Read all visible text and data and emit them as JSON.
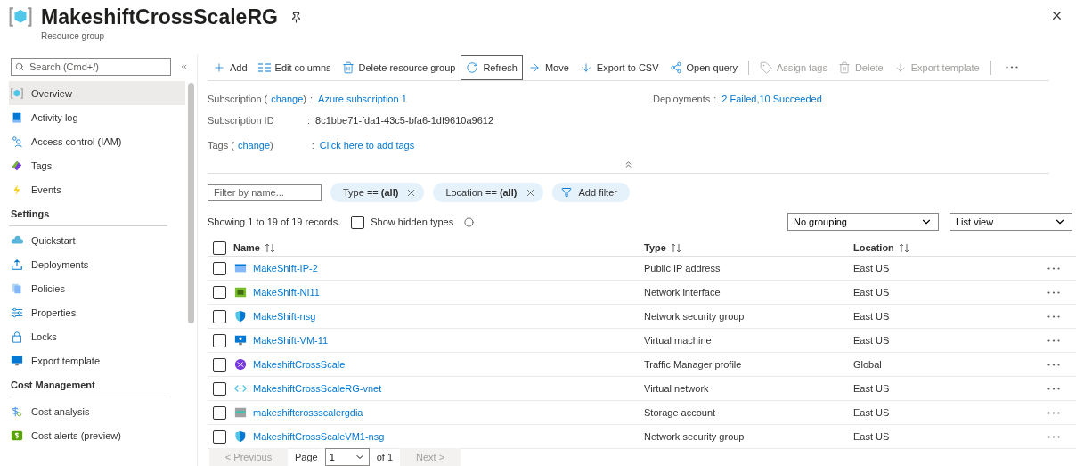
{
  "header": {
    "title": "MakeshiftCrossScaleRG",
    "subtitle": "Resource group"
  },
  "sidebar": {
    "search": {
      "placeholder": "Search (Cmd+/)"
    },
    "sections": [
      {
        "items": [
          {
            "label": "Overview",
            "selected": true
          },
          {
            "label": "Activity log",
            "selected": false
          },
          {
            "label": "Access control (IAM)",
            "selected": false
          },
          {
            "label": "Tags",
            "selected": false
          },
          {
            "label": "Events",
            "selected": false
          }
        ]
      },
      {
        "heading": "Settings",
        "items": [
          {
            "label": "Quickstart",
            "selected": false
          },
          {
            "label": "Deployments",
            "selected": false
          },
          {
            "label": "Policies",
            "selected": false
          },
          {
            "label": "Properties",
            "selected": false
          },
          {
            "label": "Locks",
            "selected": false
          },
          {
            "label": "Export template",
            "selected": false
          }
        ]
      },
      {
        "heading": "Cost Management",
        "items": [
          {
            "label": "Cost analysis",
            "selected": false
          },
          {
            "label": "Cost alerts (preview)",
            "selected": false
          }
        ]
      }
    ]
  },
  "toolbar": [
    {
      "kind": "button",
      "label": "Add",
      "disabled": false,
      "focused": false
    },
    {
      "kind": "button",
      "label": "Edit columns",
      "disabled": false,
      "focused": false
    },
    {
      "kind": "button",
      "label": "Delete resource group",
      "disabled": false,
      "focused": false
    },
    {
      "kind": "button",
      "label": "Refresh",
      "disabled": false,
      "focused": true
    },
    {
      "kind": "button",
      "label": "Move",
      "disabled": false,
      "focused": false
    },
    {
      "kind": "button",
      "label": "Export to CSV",
      "disabled": false,
      "focused": false
    },
    {
      "kind": "button",
      "label": "Open query",
      "disabled": false,
      "focused": false
    },
    {
      "kind": "separator"
    },
    {
      "kind": "button",
      "label": "Assign tags",
      "disabled": true,
      "focused": false
    },
    {
      "kind": "button",
      "label": "Delete",
      "disabled": true,
      "focused": false
    },
    {
      "kind": "button",
      "label": "Export template",
      "disabled": true,
      "focused": false
    },
    {
      "kind": "separator"
    },
    {
      "kind": "more"
    }
  ],
  "essentials": {
    "subscription": {
      "label": "Subscription (",
      "change": "change",
      "after": ")",
      "separator": ":",
      "value": "Azure subscription 1"
    },
    "subscription_id": {
      "label": "Subscription ID",
      "separator": ":",
      "value": "8c1bbe71-fda1-43c5-bfa6-1df9610a9612"
    },
    "tags": {
      "label": "Tags (",
      "change": "change",
      "after": ")",
      "separator": ":",
      "value": "Click here to add tags"
    },
    "deployments": {
      "label": "Deployments",
      "separator": ":",
      "value": "2 Failed,10 Succeeded"
    }
  },
  "filters": {
    "placeholder": "Filter by name...",
    "pills": [
      {
        "label": "Type == **(all)**"
      },
      {
        "label": "Location == **(all)**"
      }
    ],
    "add_filter": "Add filter"
  },
  "summary": {
    "text": "Showing 1 to 19 of 19 records.",
    "show_hidden": {
      "label": "Show hidden types",
      "checked": false
    },
    "grouping": "No grouping",
    "view": "List view"
  },
  "table": {
    "columns": [
      "Name",
      "Type",
      "Location"
    ],
    "all_checked": false,
    "rows": [
      {
        "name": "MakeShift-IP-2",
        "type": "Public IP address",
        "location": "East US",
        "checked": false
      },
      {
        "name": "MakeShift-NI11",
        "type": "Network interface",
        "location": "East US",
        "checked": false
      },
      {
        "name": "MakeShift-nsg",
        "type": "Network security group",
        "location": "East US",
        "checked": false
      },
      {
        "name": "MakeShift-VM-11",
        "type": "Virtual machine",
        "location": "East US",
        "checked": false
      },
      {
        "name": "MakeshiftCrossScale",
        "type": "Traffic Manager profile",
        "location": "Global",
        "checked": false
      },
      {
        "name": "MakeshiftCrossScaleRG-vnet",
        "type": "Virtual network",
        "location": "East US",
        "checked": false
      },
      {
        "name": "makeshiftcrossscalergdia",
        "type": "Storage account",
        "location": "East US",
        "checked": false
      },
      {
        "name": "MakeshiftCrossScaleVM1-nsg",
        "type": "Network security group",
        "location": "East US",
        "checked": false
      }
    ]
  },
  "pager": {
    "previous": "< Previous",
    "page_label": "Page",
    "page": "1",
    "of": "of 1",
    "next": "Next >"
  }
}
